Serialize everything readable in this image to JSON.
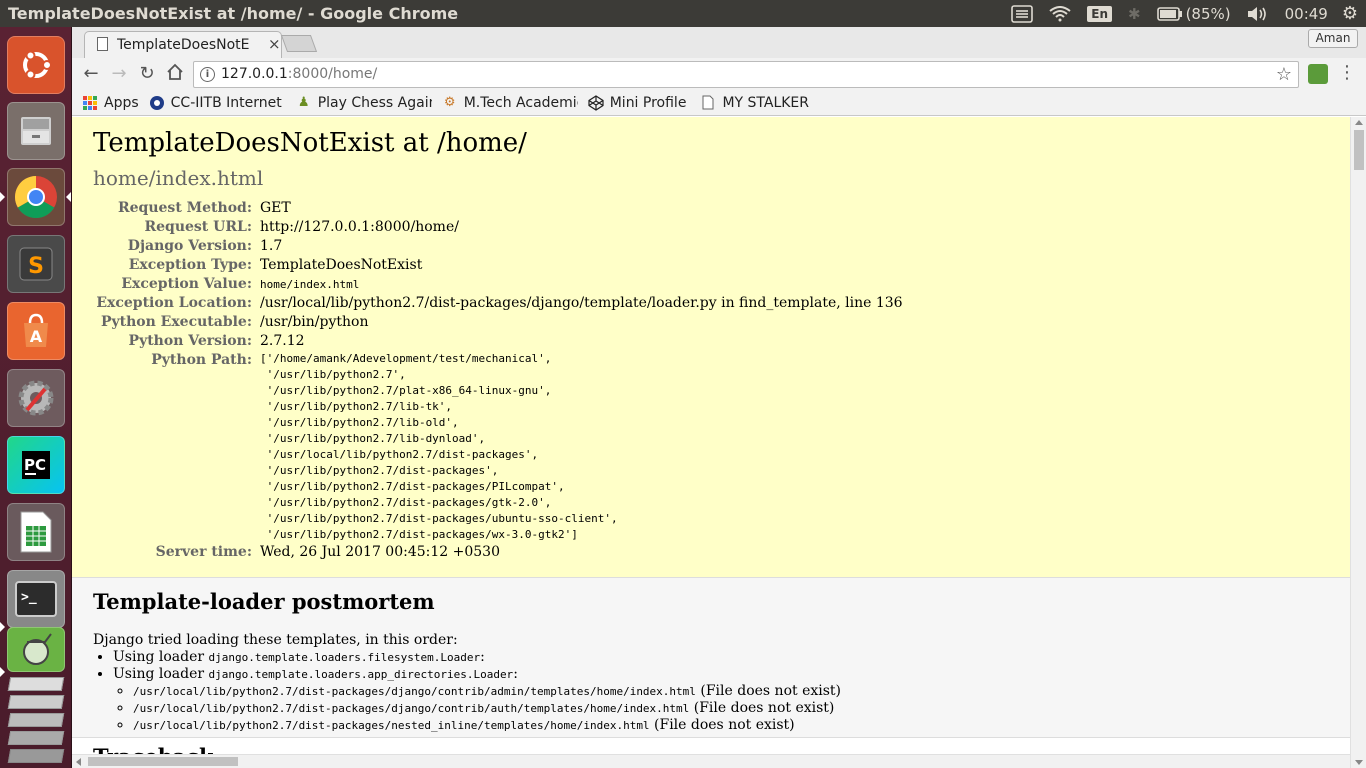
{
  "topbar": {
    "window_title": "TemplateDoesNotExist at /home/ - Google Chrome",
    "keyboard_layout": "En",
    "battery": "(85%)",
    "clock": "00:49"
  },
  "launcher": {
    "apps": [
      {
        "name": "ubuntu-dash",
        "color": "#d9532c"
      },
      {
        "name": "files",
        "color": "#8c8c8c"
      },
      {
        "name": "google-chrome",
        "color": "#4285f4"
      },
      {
        "name": "sublime-text",
        "color": "#3a3a3a"
      },
      {
        "name": "ubuntu-software",
        "color": "#e9652f"
      },
      {
        "name": "system-settings",
        "color": "#9a9a9a"
      },
      {
        "name": "pycharm",
        "color": "#21d789"
      },
      {
        "name": "libreoffice-calc",
        "color": "#2d9a3f"
      },
      {
        "name": "terminal",
        "color": "#2c2c2c"
      },
      {
        "name": "android-studio",
        "color": "#6ab344"
      }
    ]
  },
  "browser": {
    "tab_title": "TemplateDoesNotExist at /home/",
    "tab_close": "×",
    "profile_name": "Aman",
    "url_host": "127.0.0.1",
    "url_rest": ":8000/home/",
    "bookmarks": [
      {
        "label": "Apps",
        "icon": "apps-grid-icon"
      },
      {
        "label": "CC-IITB Internet",
        "icon": "iitb-icon"
      },
      {
        "label": "Play Chess Again",
        "icon": "chess-pawn-icon"
      },
      {
        "label": "M.Tech Academic",
        "icon": "gear-icon"
      },
      {
        "label": "Mini Profile",
        "icon": "codepen-icon"
      },
      {
        "label": "MY STALKER",
        "icon": "page-icon"
      }
    ]
  },
  "error": {
    "title": "TemplateDoesNotExist at /home/",
    "subtitle": "home/index.html",
    "meta": [
      {
        "key": "Request Method:",
        "value": "GET"
      },
      {
        "key": "Request URL:",
        "value": "http://127.0.0.1:8000/home/"
      },
      {
        "key": "Django Version:",
        "value": "1.7"
      },
      {
        "key": "Exception Type:",
        "value": "TemplateDoesNotExist"
      },
      {
        "key": "Exception Value:",
        "value": "home/index.html"
      },
      {
        "key": "Exception Location:",
        "value": "/usr/local/lib/python2.7/dist-packages/django/template/loader.py in find_template, line 136"
      },
      {
        "key": "Python Executable:",
        "value": "/usr/bin/python"
      },
      {
        "key": "Python Version:",
        "value": "2.7.12"
      },
      {
        "key": "Python Path:",
        "value": "['/home/amank/Adevelopment/test/mechanical',\n '/usr/lib/python2.7',\n '/usr/lib/python2.7/plat-x86_64-linux-gnu',\n '/usr/lib/python2.7/lib-tk',\n '/usr/lib/python2.7/lib-old',\n '/usr/lib/python2.7/lib-dynload',\n '/usr/local/lib/python2.7/dist-packages',\n '/usr/lib/python2.7/dist-packages',\n '/usr/lib/python2.7/dist-packages/PILcompat',\n '/usr/lib/python2.7/dist-packages/gtk-2.0',\n '/usr/lib/python2.7/dist-packages/ubuntu-sso-client',\n '/usr/lib/python2.7/dist-packages/wx-3.0-gtk2']"
      },
      {
        "key": "Server time:",
        "value": "Wed, 26 Jul 2017 00:45:12 +0530"
      }
    ]
  },
  "postmortem": {
    "heading": "Template-loader postmortem",
    "intro": "Django tried loading these templates, in this order:",
    "using_loader": "Using loader",
    "loader1": "django.template.loaders.filesystem.Loader",
    "loader2": "django.template.loaders.app_directories.Loader",
    "colon": ":",
    "files": [
      {
        "path": "/usr/local/lib/python2.7/dist-packages/django/contrib/admin/templates/home/index.html",
        "status": "(File does not exist)"
      },
      {
        "path": "/usr/local/lib/python2.7/dist-packages/django/contrib/auth/templates/home/index.html",
        "status": "(File does not exist)"
      },
      {
        "path": "/usr/local/lib/python2.7/dist-packages/nested_inline/templates/home/index.html",
        "status": "(File does not exist)"
      }
    ]
  },
  "next_section": {
    "heading": "Traceback"
  }
}
